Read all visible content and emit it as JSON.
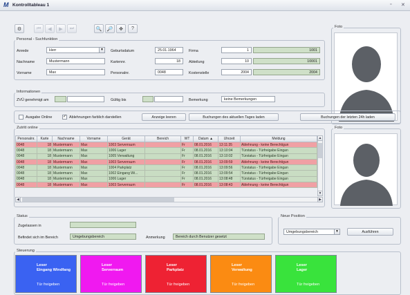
{
  "window": {
    "title": "Kontrolltableau 1",
    "logo": "M",
    "restore_glyph": "▫",
    "close_glyph": "✕"
  },
  "toolbar": [
    {
      "name": "config-icon",
      "glyph": "⚙",
      "disabled": false
    },
    {
      "name": "first-record-icon",
      "glyph": "⏮",
      "disabled": true
    },
    {
      "name": "previous-record-icon",
      "glyph": "◀",
      "disabled": true
    },
    {
      "name": "next-record-icon",
      "glyph": "▶",
      "disabled": true
    },
    {
      "name": "last-record-icon",
      "glyph": "⏭",
      "disabled": true
    },
    {
      "name": "search-icon",
      "glyph": "🔍",
      "disabled": false
    },
    {
      "name": "search-advanced-icon",
      "glyph": "🔎",
      "disabled": false
    },
    {
      "name": "navigate-icon",
      "glyph": "✥",
      "disabled": false
    },
    {
      "name": "help-icon",
      "glyph": "?",
      "disabled": false
    }
  ],
  "person": {
    "group_label": "Personal - Suchfunktion",
    "anrede_label": "Anrede",
    "anrede_value": "Herr",
    "nachname_label": "Nachname",
    "nachname_value": "Mustermann",
    "vorname_label": "Vorname",
    "vorname_value": "Max",
    "geburtsdatum_label": "Geburtsdatum",
    "geburtsdatum_value": "25.01.1964",
    "kartennr_label": "Kartennr.",
    "kartennr_value": "18",
    "personalnr_label": "Personalnr.",
    "personalnr_value": "0048",
    "firma_label": "Firma",
    "firma_value": "1",
    "firma_code": "1001",
    "abteilung_label": "Abteilung",
    "abteilung_value": "10",
    "abteilung_code": "10001",
    "kostenstelle_label": "Kostenstelle",
    "kostenstelle_value": "2004",
    "kostenstelle_code": "2004"
  },
  "photo_label_1": "Foto",
  "photo_label_2": "Foto",
  "info": {
    "group_label": "Informationen",
    "zvu_label": "ZVÜ genehmigt am",
    "gueltig_label": "Gültig bis",
    "bemerkung_label": "Bemerkung",
    "bemerkung_value": "keine Bemerkungen"
  },
  "options": {
    "ausgabe_online": "Ausgabe Online",
    "ausgabe_checked": false,
    "ablehnungen": "Ablehnungen farblich darstellen",
    "ablehnungen_checked": true,
    "btn_anzeige": "Anzeige leeren",
    "btn_tages": "Buchungen des aktuellen Tages laden",
    "btn_24h": "Buchungen der letzten 24h laden"
  },
  "zutritt": {
    "group_label": "Zutritt online",
    "columns": [
      "Personalnr.",
      "Karte",
      "Nachname",
      "Vorname",
      "Gerät",
      "Bereich",
      "WT",
      "Datum ▲",
      "Uhrzeit",
      "Meldung"
    ],
    "rows": [
      {
        "color": "p",
        "cells": [
          "0048",
          "18",
          "Mustermann",
          "Max",
          "1003 Serverraum",
          "",
          "Fr",
          "08.01.2016",
          "13:11:35",
          "Ablehnung - keine Berechtigun"
        ]
      },
      {
        "color": "g",
        "cells": [
          "0048",
          "18",
          "Mustermann",
          "Max",
          "1006 Lager",
          "",
          "Fr",
          "08.01.2016",
          "13:10:04",
          "Türstatus - Türfreigabe Eingan"
        ]
      },
      {
        "color": "g",
        "cells": [
          "0048",
          "18",
          "Mustermann",
          "Max",
          "1005 Verwaltung",
          "",
          "Fr",
          "08.01.2016",
          "13:10:02",
          "Türstatus - Türfreigabe Eingan"
        ]
      },
      {
        "color": "p",
        "cells": [
          "0048",
          "18",
          "Mustermann",
          "Max",
          "1003 Serverraum",
          "",
          "Fr",
          "08.01.2016",
          "13:09:59",
          "Ablehnung - keine Berechtigun"
        ]
      },
      {
        "color": "g",
        "cells": [
          "0048",
          "18",
          "Mustermann",
          "Max",
          "1004 Parkplatz",
          "",
          "Fr",
          "08.01.2016",
          "13:09:56",
          "Türstatus - Türfreigabe Eingan"
        ]
      },
      {
        "color": "g",
        "cells": [
          "0048",
          "18",
          "Mustermann",
          "Max",
          "1002 Eingang Wi...",
          "",
          "Fr",
          "08.01.2016",
          "13:09:54",
          "Türstatus - Türfreigabe Eingan"
        ]
      },
      {
        "color": "g",
        "cells": [
          "0048",
          "18",
          "Mustermann",
          "Max",
          "1006 Lager",
          "",
          "Fr",
          "08.01.2016",
          "13:08:48",
          "Türstatus - Türfreigabe Eingan"
        ]
      },
      {
        "color": "p",
        "cells": [
          "0048",
          "18",
          "Mustermann",
          "Max",
          "1003 Serverraum",
          "",
          "Fr",
          "08.01.2016",
          "13:08:43",
          "Ablehnung - keine Berechtigun"
        ]
      }
    ]
  },
  "status": {
    "group_label": "Status",
    "zugelassen_label": "Zugelassen in",
    "befindet_label": "Befindet sich im Bereich",
    "befindet_value": "Umgebungsbereich",
    "anmerkung_label": "Anmerkung",
    "anmerkung_value": "Bereich durch Benutzer gesetzt"
  },
  "neue_position": {
    "group_label": "Neue Position",
    "select_value": "Umgebungsbereich",
    "execute": "Ausführen"
  },
  "steuerung": {
    "group_label": "Steuerung",
    "tiles": [
      {
        "line1": "Leser",
        "line2": "Eingang Windfang",
        "line3": "Tür freigeben",
        "color": "#3a62f2"
      },
      {
        "line1": "Leser",
        "line2": "Serverraum",
        "line3": "Tür freigeben",
        "color": "#f019f0"
      },
      {
        "line1": "Leser",
        "line2": "Parkplatz",
        "line3": "Tür freigeben",
        "color": "#ee2233"
      },
      {
        "line1": "Leser",
        "line2": "Verwaltung",
        "line3": "Tür freigeben",
        "color": "#fb8b12"
      },
      {
        "line1": "Leser",
        "line2": "Lager",
        "line3": "Tür freigeben",
        "color": "#39e33c"
      }
    ]
  }
}
